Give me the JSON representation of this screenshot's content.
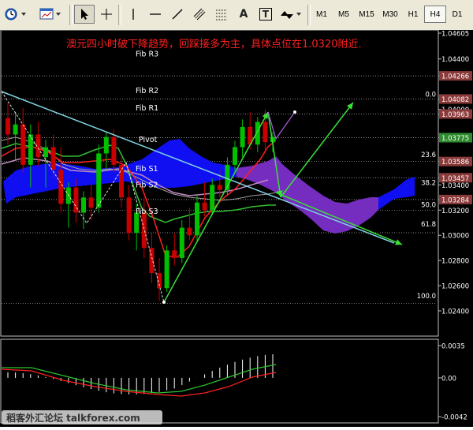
{
  "toolbar": {
    "tools": [
      "clock-icon",
      "chart-window-icon",
      "cursor-icon",
      "crosshair-icon",
      "vertical-line-icon",
      "horizontal-line-icon",
      "trendline-icon",
      "equidistant-channel-icon",
      "fibonacci-icon",
      "text-icon",
      "text-label-icon",
      "arrows-icon"
    ],
    "text_tool_label": "A",
    "label_tool_label": "T",
    "timeframes": [
      "M1",
      "M5",
      "M15",
      "M30",
      "H1",
      "H4",
      "D1"
    ],
    "active_timeframe": "H4"
  },
  "chart": {
    "annotation": "澳元四小时破下降趋势，回踩接多为主，具体点位在1.0320附近.",
    "annotation_color": "#ff2020",
    "price_axis_labels": [
      "1.04605",
      "1.04400",
      "1.04266",
      "1.04082",
      "1.04000",
      "1.03963",
      "1.03775",
      "1.03586",
      "1.03457",
      "1.03400",
      "1.03284",
      "1.03200",
      "1.03000",
      "1.02800",
      "1.02600",
      "1.02400"
    ],
    "highlighted_prices": {
      "1.04266": "#8b3a3a",
      "1.04082": "#8b3a3a",
      "1.03963": "#8b3a3a",
      "1.03775": "#2e8b2e",
      "1.03586": "#8b3a3a",
      "1.03457": "#8b3a3a",
      "1.03284": "#8b3a3a"
    },
    "pivot_levels": [
      "Fib R3",
      "Fib R2",
      "Fib R1",
      "Pivot",
      "Fib S1",
      "Fib S2",
      "Fib S3"
    ],
    "fib_retracement_levels": [
      "0.0",
      "23.6",
      "38.2",
      "50.0",
      "61.8",
      "100.0"
    ],
    "indicator_axis_labels": [
      "0.0035",
      "0.00",
      "-0.0042"
    ],
    "colors": {
      "bull_candle": "#00c000",
      "bear_candle": "#c80000",
      "cloud_bearish": "#1010ff",
      "cloud_bullish": "#7a2fc8",
      "trendline": "#7fd3e0",
      "fib_arrows": "#38e038"
    }
  },
  "watermark": {
    "text": "稻客外汇论坛 talkforex.com"
  }
}
